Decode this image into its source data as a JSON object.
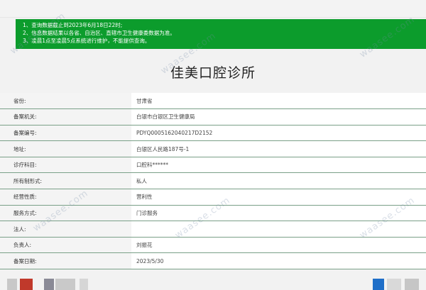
{
  "notice": {
    "lines": [
      "1、查询数据截止到2023年6月18日22时;",
      "2、信息数据结果以各省、自治区、直辖市卫生健康委数据为准。",
      "3、凌晨1点至凌晨5点系统进行维护，不能提供查询。"
    ]
  },
  "title": "佳美口腔诊所",
  "rows": [
    {
      "label": "省份:",
      "value": "甘肃省"
    },
    {
      "label": "备案机关:",
      "value": "白银市白银区卫生健康局"
    },
    {
      "label": "备案编号:",
      "value": "PDYQ0005162040217D2152"
    },
    {
      "label": "地址:",
      "value": "白银区人民路187号-1"
    },
    {
      "label": "诊疗科目:",
      "value": "口腔科******"
    },
    {
      "label": "所有制形式:",
      "value": "私人"
    },
    {
      "label": "经营性质:",
      "value": "营利性"
    },
    {
      "label": "服务方式:",
      "value": "门诊服务"
    },
    {
      "label": "法人:",
      "value": ""
    },
    {
      "label": "负责人:",
      "value": "刘振花"
    },
    {
      "label": "备案日期:",
      "value": "2023/5/30"
    }
  ],
  "watermark": "waasee.com",
  "colors": {
    "notice_bg": "#0c9c2c",
    "row_border": "#7aa088"
  }
}
